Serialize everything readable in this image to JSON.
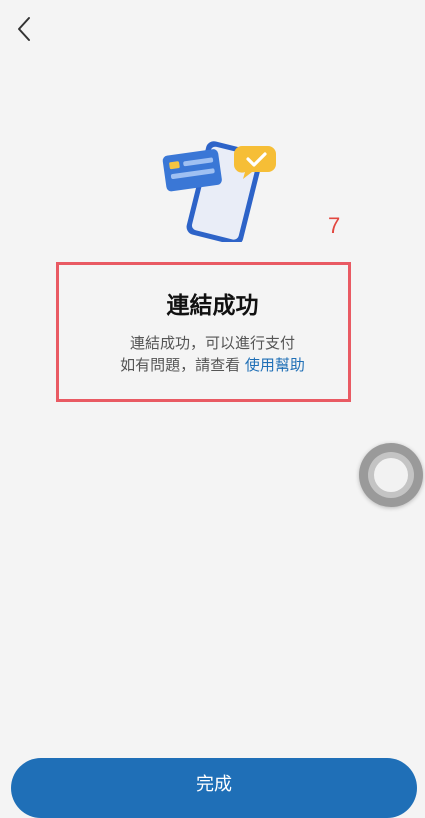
{
  "nav": {
    "back_icon": "chevron-left-icon"
  },
  "illustration": {
    "icon": "phone-card-check-icon"
  },
  "step_label": "7",
  "status": {
    "title": "連結成功",
    "line1": "連結成功，可以進行支付",
    "line2_prefix": "如有問題，請查看",
    "help_link": "使用幫助"
  },
  "floating_button": {
    "icon": "assistive-touch-icon"
  },
  "footer": {
    "done_label": "完成"
  },
  "colors": {
    "primary": "#1f6fb7",
    "highlight": "#e95a63",
    "annotation": "#e2473f",
    "background": "#f4f4f4"
  }
}
